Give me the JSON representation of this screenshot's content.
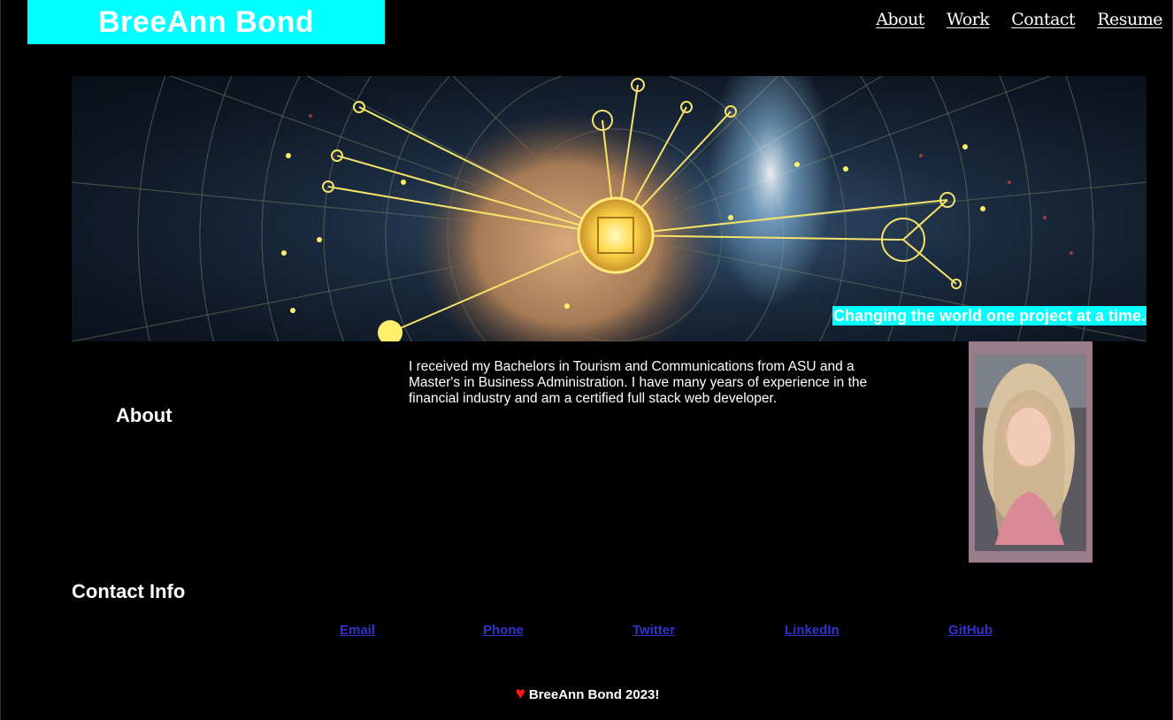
{
  "header": {
    "brand": "BreeAnn Bond",
    "nav": [
      "About",
      "Work",
      "Contact",
      "Resume"
    ]
  },
  "hero": {
    "tagline": "Changing the world one project at a time."
  },
  "about": {
    "heading": "About",
    "text": "I received my Bachelors in Tourism and Communications from ASU and a Master's in Business Administration. I have many years of experience in the financial industry and am a certified full stack web developer."
  },
  "contact": {
    "heading": "Contact Info",
    "links": [
      "Email",
      "Phone",
      "Twitter",
      "LinkedIn",
      "GitHub"
    ]
  },
  "footer": {
    "heart": "♥",
    "text": "BreeAnn Bond 2023!"
  },
  "colors": {
    "accent": "#00ffff",
    "background": "#000000",
    "link": "#3333cc",
    "heart": "#ff1a1a"
  },
  "icons": {
    "heart": "heart-icon"
  }
}
